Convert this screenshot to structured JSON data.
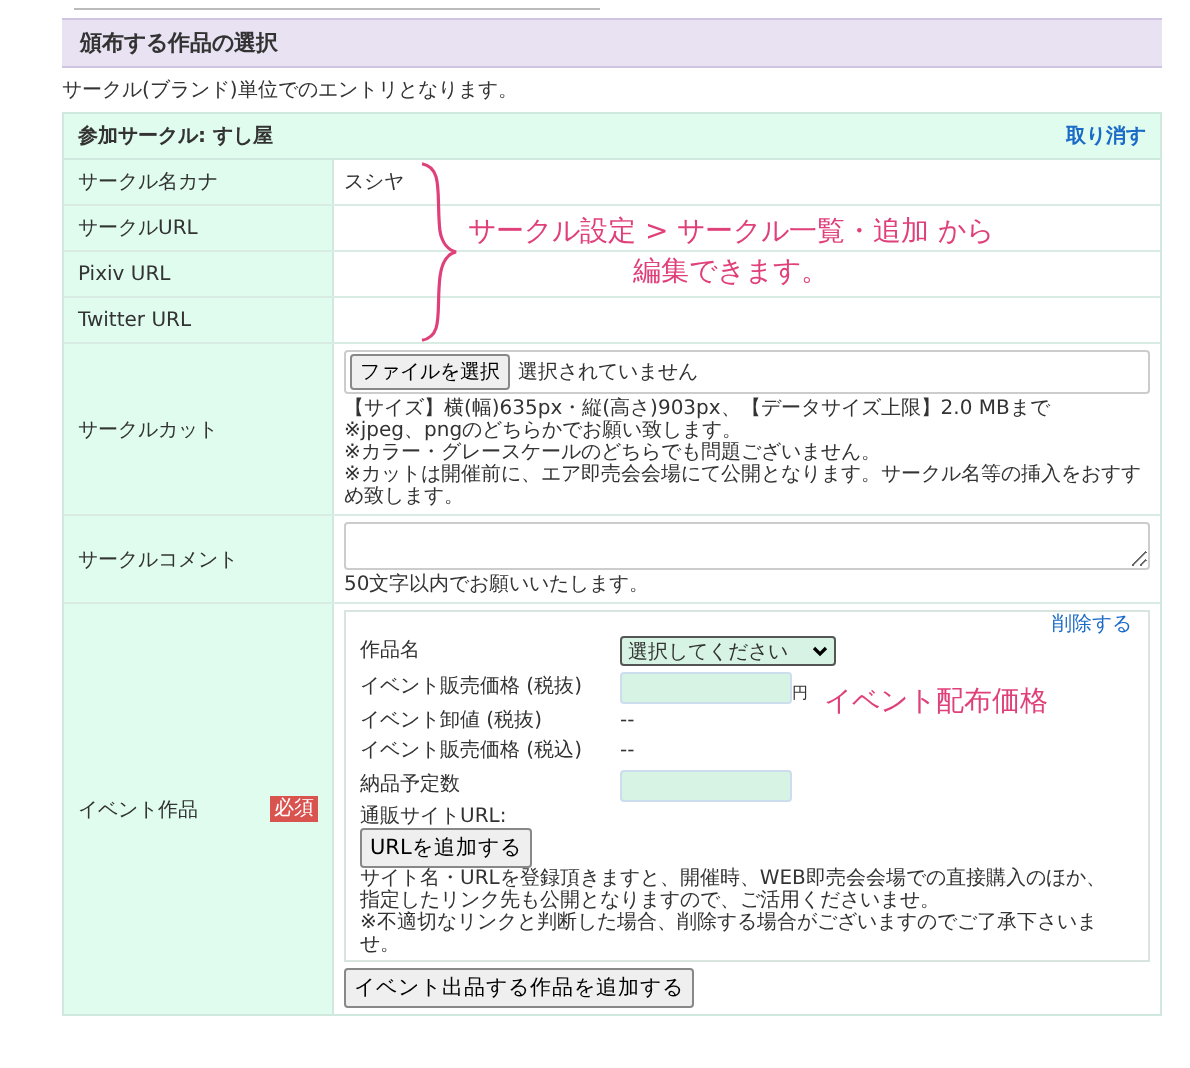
{
  "section_title": "頒布する作品の選択",
  "intro": "サークル(ブランド)単位でのエントリとなります。",
  "circle": {
    "title": "参加サークル: すし屋",
    "cancel_link": "取り消す",
    "rows": [
      {
        "kind": "text",
        "label": "サークル名カナ",
        "value": "スシヤ"
      },
      {
        "kind": "text",
        "label": "サークルURL"
      },
      {
        "kind": "text",
        "label": "Pixiv URL"
      },
      {
        "kind": "text",
        "label": "Twitter URL"
      },
      {
        "kind": "file",
        "label": "サークルカット",
        "button": "ファイルを選択",
        "status": "選択されていません",
        "notes": [
          "【サイズ】横(幅)635px・縦(高さ)903px、【データサイズ上限】2.0 MBまで",
          "※jpeg、pngのどちらかでお願い致します。",
          "※カラー・グレースケールのどちらでも問題ございません。",
          "※カットは開催前に、エア即売会会場にて公開となります。サークル名等の挿入をおすすめ致します。"
        ]
      },
      {
        "kind": "textarea",
        "label": "サークルコメント",
        "notes": [
          "50文字以内でお願いいたします。"
        ]
      },
      {
        "kind": "works",
        "label": "イベント作品",
        "required_badge": "必須",
        "work": {
          "delete_link": "削除する",
          "fields": [
            {
              "kind": "select",
              "label": "作品名",
              "value": "選択してください"
            },
            {
              "kind": "input",
              "label": "イベント販売価格 (税抜)",
              "unit": "円"
            },
            {
              "kind": "text",
              "label": "イベント卸値 (税抜)",
              "value": "--"
            },
            {
              "kind": "text",
              "label": "イベント販売価格 (税込)",
              "value": "--"
            },
            {
              "kind": "input",
              "label": "納品予定数"
            }
          ],
          "shop_url_label": "通販サイトURL:",
          "url_button": "URLを追加する",
          "notes": [
            "サイト名・URLを登録頂きますと、開催時、WEB即売会会場での直接購入のほか、",
            "指定したリンク先も公開となりますので、ご活用くださいませ。",
            "※不適切なリンクと判断した場合、削除する場合がございますのでご了承下さいませ。"
          ]
        },
        "add_button": "イベント出品する作品を追加する"
      }
    ]
  },
  "annotations": [
    {
      "kind": "brace",
      "lines": [
        "サークル設定 > サークル一覧・追加 から",
        "編集できます。"
      ]
    },
    {
      "kind": "plain",
      "lines": [
        "イベント配布価格"
      ]
    }
  ]
}
